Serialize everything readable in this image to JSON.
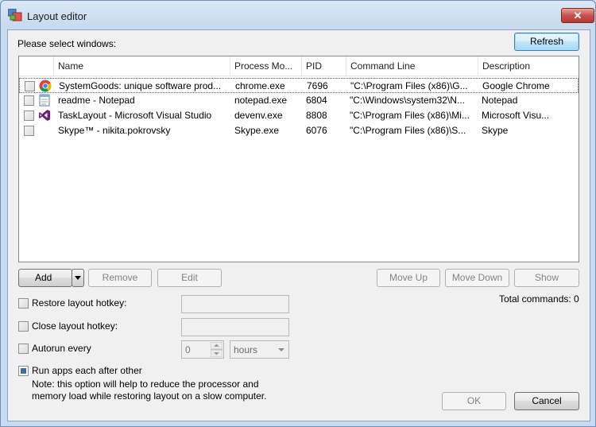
{
  "window": {
    "title": "Layout editor",
    "close_glyph": "✕"
  },
  "prompt": "Please select windows:",
  "refresh_label": "Refresh",
  "table": {
    "columns": [
      "Name",
      "Process Mo...",
      "PID",
      "Command Line",
      "Description"
    ],
    "rows": [
      {
        "icon": "chrome-icon",
        "name": "SystemGoods: unique software prod...",
        "process": "chrome.exe",
        "pid": "7696",
        "command": "\"C:\\Program Files (x86)\\G...",
        "description": "Google Chrome"
      },
      {
        "icon": "notepad-icon",
        "name": "readme - Notepad",
        "process": "notepad.exe",
        "pid": "6804",
        "command": "\"C:\\Windows\\system32\\N...",
        "description": "Notepad"
      },
      {
        "icon": "visual-studio-icon",
        "name": "TaskLayout - Microsoft Visual Studio",
        "process": "devenv.exe",
        "pid": "8808",
        "command": "\"C:\\Program Files (x86)\\Mi...",
        "description": "Microsoft Visu..."
      },
      {
        "icon": "skype-icon",
        "name": "Skype™ - nikita.pokrovsky",
        "process": "Skype.exe",
        "pid": "6076",
        "command": "\"C:\\Program Files (x86)\\S...",
        "description": "Skype"
      }
    ]
  },
  "buttons": {
    "add": "Add",
    "remove": "Remove",
    "edit": "Edit",
    "move_up": "Move Up",
    "move_down": "Move Down",
    "show": "Show",
    "ok": "OK",
    "cancel": "Cancel"
  },
  "total_commands": "Total commands: 0",
  "options": {
    "restore_hotkey": "Restore layout hotkey:",
    "close_hotkey": "Close layout hotkey:",
    "autorun": "Autorun every",
    "autorun_value": "0",
    "autorun_unit": "hours",
    "run_after": "Run apps each after other",
    "note_line1": "Note: this option will help to reduce the processor and",
    "note_line2": "memory load while restoring layout on a slow computer."
  },
  "colors": {
    "accent": "#3a6ea5",
    "window_frame": "#c8daee",
    "close_red": "#c75050"
  }
}
